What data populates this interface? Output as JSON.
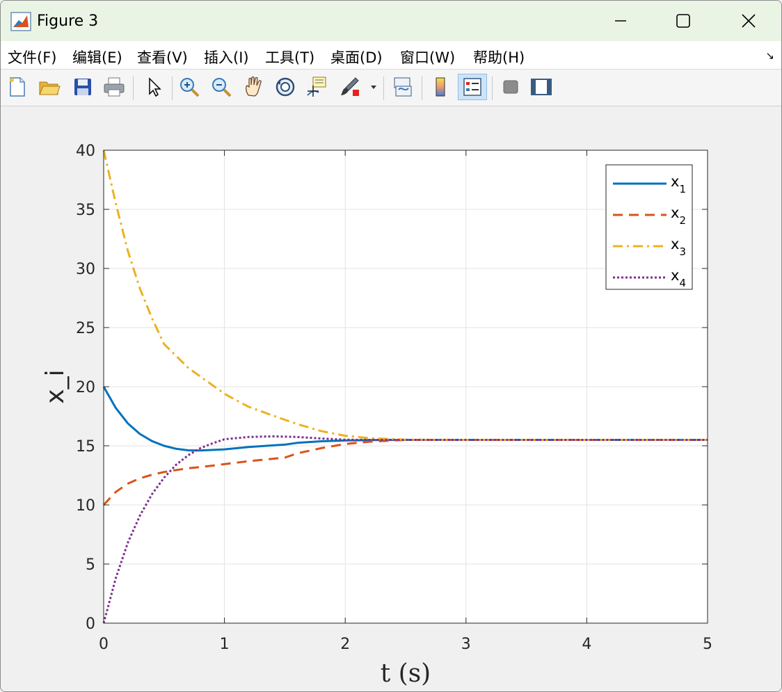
{
  "window": {
    "title": "Figure 3"
  },
  "menu": [
    "文件(F)",
    "编辑(E)",
    "查看(V)",
    "插入(I)",
    "工具(T)",
    "桌面(D)",
    "窗口(W)",
    "帮助(H)"
  ],
  "toolbar": [
    "new-figure-icon",
    "open-file-icon",
    "save-icon",
    "print-icon",
    "pointer-icon",
    "zoom-in-icon",
    "zoom-out-icon",
    "pan-hand-icon",
    "rotate-3d-icon",
    "data-cursor-icon",
    "brush-icon",
    "link-plot-icon",
    "colorbar-icon",
    "legend-icon",
    "hide-plot-tools-icon",
    "show-plot-tools-icon"
  ],
  "colors": {
    "x1": "#0072BD",
    "x2": "#D95319",
    "x3": "#EDB120",
    "x4": "#7E2F8E",
    "titlebar": "#eaf4e5"
  },
  "chart_data": {
    "type": "line",
    "xlabel": "t (s)",
    "ylabel": "x_i",
    "xlim": [
      0,
      5
    ],
    "ylim": [
      0,
      40
    ],
    "xticks": [
      0,
      1,
      2,
      3,
      4,
      5
    ],
    "yticks": [
      0,
      5,
      10,
      15,
      20,
      25,
      30,
      35,
      40
    ],
    "grid": true,
    "legend_position": "top-right",
    "series": [
      {
        "name": "x1",
        "label_main": "x",
        "label_sub": "1",
        "style": "solid",
        "color": "#0072BD",
        "x": [
          0,
          0.1,
          0.2,
          0.3,
          0.4,
          0.5,
          0.6,
          0.7,
          0.8,
          1.0,
          1.2,
          1.5,
          1.6,
          1.8,
          2.0,
          2.2,
          2.5,
          3,
          4,
          5
        ],
        "y": [
          20,
          18.2,
          16.9,
          16.0,
          15.4,
          15.0,
          14.75,
          14.62,
          14.6,
          14.7,
          14.9,
          15.1,
          15.25,
          15.38,
          15.45,
          15.48,
          15.5,
          15.5,
          15.5,
          15.5
        ]
      },
      {
        "name": "x2",
        "label_main": "x",
        "label_sub": "2",
        "style": "dashed",
        "color": "#D95319",
        "x": [
          0,
          0.1,
          0.2,
          0.3,
          0.4,
          0.5,
          0.6,
          0.7,
          0.8,
          1.0,
          1.2,
          1.5,
          1.6,
          1.8,
          2.0,
          2.2,
          2.5,
          3,
          4,
          5
        ],
        "y": [
          10,
          11.1,
          11.8,
          12.25,
          12.55,
          12.78,
          12.95,
          13.1,
          13.2,
          13.45,
          13.7,
          14.0,
          14.35,
          14.8,
          15.15,
          15.35,
          15.5,
          15.5,
          15.5,
          15.5
        ]
      },
      {
        "name": "x3",
        "label_main": "x",
        "label_sub": "3",
        "style": "dashdot",
        "color": "#EDB120",
        "x": [
          0,
          0.1,
          0.2,
          0.3,
          0.4,
          0.5,
          0.7,
          1.0,
          1.2,
          1.5,
          1.6,
          1.8,
          2.0,
          2.2,
          2.5,
          3,
          4,
          5
        ],
        "y": [
          40,
          35.5,
          31.5,
          28.3,
          25.8,
          23.6,
          21.6,
          19.4,
          18.3,
          17.2,
          16.85,
          16.25,
          15.85,
          15.65,
          15.52,
          15.5,
          15.5,
          15.5
        ]
      },
      {
        "name": "x4",
        "label_main": "x",
        "label_sub": "4",
        "style": "dotted",
        "color": "#7E2F8E",
        "x": [
          0,
          0.1,
          0.2,
          0.3,
          0.4,
          0.5,
          0.6,
          0.7,
          0.8,
          0.9,
          1.0,
          1.2,
          1.4,
          1.6,
          1.8,
          2.0,
          2.2,
          2.5,
          3,
          4,
          5
        ],
        "y": [
          0,
          3.8,
          6.8,
          9.1,
          10.9,
          12.3,
          13.4,
          14.2,
          14.8,
          15.2,
          15.55,
          15.75,
          15.8,
          15.75,
          15.62,
          15.52,
          15.5,
          15.5,
          15.5,
          15.5,
          15.5
        ]
      }
    ]
  }
}
